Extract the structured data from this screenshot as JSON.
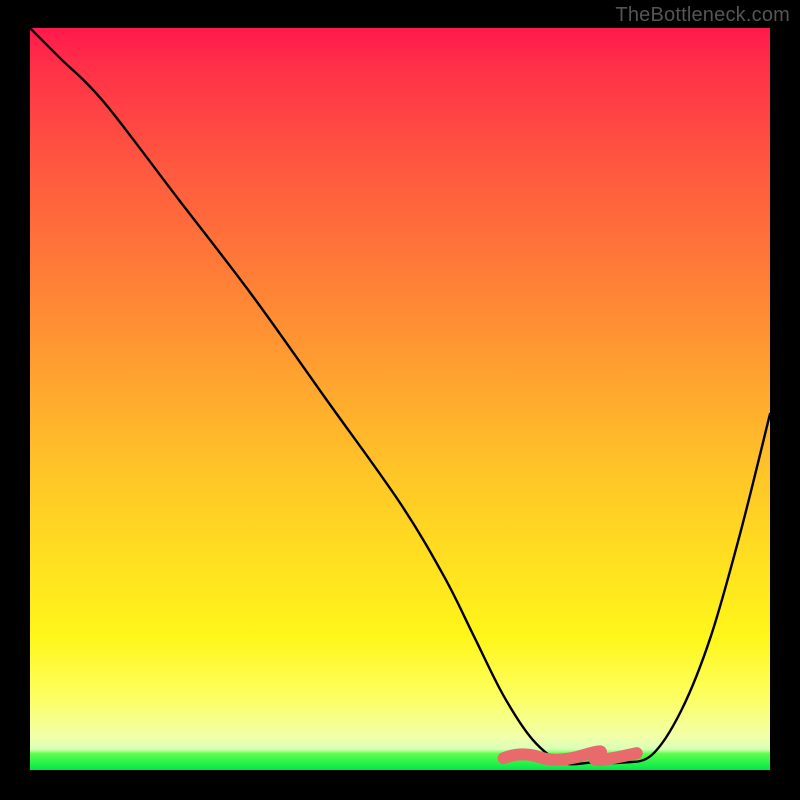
{
  "watermark": {
    "text": "TheBottleneck.com"
  },
  "chart_data": {
    "type": "line",
    "title": "",
    "xlabel": "",
    "ylabel": "",
    "xlim": [
      0,
      100
    ],
    "ylim": [
      0,
      100
    ],
    "series": [
      {
        "name": "bottleneck-curve",
        "x": [
          0,
          4,
          10,
          20,
          30,
          40,
          50,
          56,
          60,
          64,
          68,
          72,
          76,
          80,
          84,
          88,
          92,
          96,
          100
        ],
        "y": [
          100,
          96,
          90,
          77,
          64,
          50,
          36,
          26,
          18,
          10,
          4,
          1,
          1,
          1,
          2,
          8,
          18,
          32,
          48
        ]
      }
    ],
    "annotations": [
      {
        "name": "flat-minimum-marker",
        "x_start": 64,
        "x_end": 82,
        "y": 2
      }
    ],
    "background_gradient": {
      "stops": [
        {
          "pos": 0,
          "color": "#ff1a4d"
        },
        {
          "pos": 0.46,
          "color": "#ffa030"
        },
        {
          "pos": 0.82,
          "color": "#fff61a"
        },
        {
          "pos": 0.978,
          "color": "#5cff4a"
        },
        {
          "pos": 1.0,
          "color": "#00e84a"
        }
      ]
    }
  }
}
